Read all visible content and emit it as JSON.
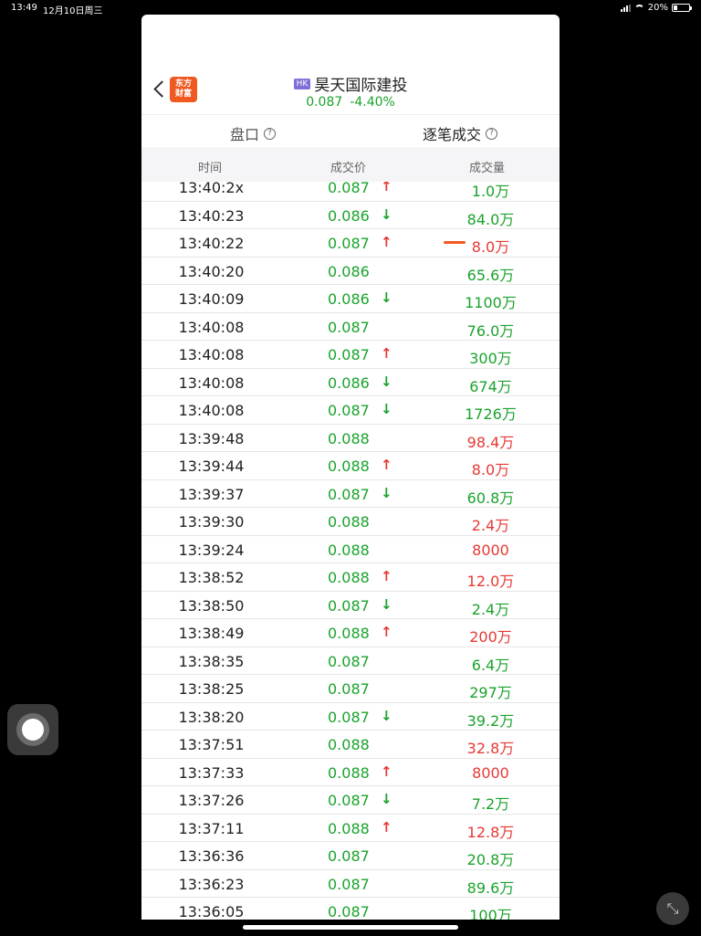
{
  "status_bar": {
    "time": "13:49",
    "date": "12月10日周三",
    "battery": "20%"
  },
  "header": {
    "logo_line1": "东方",
    "logo_line2": "财富",
    "market_badge": "HK",
    "stock_name": "昊天国际建投",
    "price": "0.087",
    "change_pct": "-4.40%"
  },
  "tabs": [
    {
      "label": "盘口"
    },
    {
      "label": "逐笔成交"
    }
  ],
  "table": {
    "columns": [
      "时间",
      "成交价",
      "成交量"
    ],
    "rows": [
      {
        "time": "13:40:2x",
        "price": "0.087",
        "dir": "up",
        "volume": "1.0万",
        "volume_color": "green"
      },
      {
        "time": "13:40:23",
        "price": "0.086",
        "dir": "down",
        "volume": "84.0万",
        "volume_color": "green"
      },
      {
        "time": "13:40:22",
        "price": "0.087",
        "dir": "up",
        "volume": "8.0万",
        "volume_color": "red"
      },
      {
        "time": "13:40:20",
        "price": "0.086",
        "dir": "",
        "volume": "65.6万",
        "volume_color": "green"
      },
      {
        "time": "13:40:09",
        "price": "0.086",
        "dir": "down",
        "volume": "1100万",
        "volume_color": "green"
      },
      {
        "time": "13:40:08",
        "price": "0.087",
        "dir": "",
        "volume": "76.0万",
        "volume_color": "green"
      },
      {
        "time": "13:40:08",
        "price": "0.087",
        "dir": "up",
        "volume": "300万",
        "volume_color": "green"
      },
      {
        "time": "13:40:08",
        "price": "0.086",
        "dir": "down",
        "volume": "674万",
        "volume_color": "green"
      },
      {
        "time": "13:40:08",
        "price": "0.087",
        "dir": "down",
        "volume": "1726万",
        "volume_color": "green"
      },
      {
        "time": "13:39:48",
        "price": "0.088",
        "dir": "",
        "volume": "98.4万",
        "volume_color": "red"
      },
      {
        "time": "13:39:44",
        "price": "0.088",
        "dir": "up",
        "volume": "8.0万",
        "volume_color": "red"
      },
      {
        "time": "13:39:37",
        "price": "0.087",
        "dir": "down",
        "volume": "60.8万",
        "volume_color": "green"
      },
      {
        "time": "13:39:30",
        "price": "0.088",
        "dir": "",
        "volume": "2.4万",
        "volume_color": "red"
      },
      {
        "time": "13:39:24",
        "price": "0.088",
        "dir": "",
        "volume": "8000",
        "volume_color": "red"
      },
      {
        "time": "13:38:52",
        "price": "0.088",
        "dir": "up",
        "volume": "12.0万",
        "volume_color": "red"
      },
      {
        "time": "13:38:50",
        "price": "0.087",
        "dir": "down",
        "volume": "2.4万",
        "volume_color": "green"
      },
      {
        "time": "13:38:49",
        "price": "0.088",
        "dir": "up",
        "volume": "200万",
        "volume_color": "red"
      },
      {
        "time": "13:38:35",
        "price": "0.087",
        "dir": "",
        "volume": "6.4万",
        "volume_color": "green"
      },
      {
        "time": "13:38:25",
        "price": "0.087",
        "dir": "",
        "volume": "297万",
        "volume_color": "green"
      },
      {
        "time": "13:38:20",
        "price": "0.087",
        "dir": "down",
        "volume": "39.2万",
        "volume_color": "green"
      },
      {
        "time": "13:37:51",
        "price": "0.088",
        "dir": "",
        "volume": "32.8万",
        "volume_color": "red"
      },
      {
        "time": "13:37:33",
        "price": "0.088",
        "dir": "up",
        "volume": "8000",
        "volume_color": "red"
      },
      {
        "time": "13:37:26",
        "price": "0.087",
        "dir": "down",
        "volume": "7.2万",
        "volume_color": "green"
      },
      {
        "time": "13:37:11",
        "price": "0.088",
        "dir": "up",
        "volume": "12.8万",
        "volume_color": "red"
      },
      {
        "time": "13:36:36",
        "price": "0.087",
        "dir": "",
        "volume": "20.8万",
        "volume_color": "green"
      },
      {
        "time": "13:36:23",
        "price": "0.087",
        "dir": "",
        "volume": "89.6万",
        "volume_color": "green"
      },
      {
        "time": "13:36:05",
        "price": "0.087",
        "dir": "",
        "volume": "100万",
        "volume_color": "green"
      }
    ]
  },
  "icons": {
    "back": "chevron-left-icon",
    "help": "question-circle-icon",
    "up_arrow": "↑",
    "down_arrow": "↓"
  },
  "colors": {
    "up": "#e53935",
    "down": "#1aa32c",
    "brand": "#f05a22",
    "hk_badge": "#7e6fd6"
  }
}
